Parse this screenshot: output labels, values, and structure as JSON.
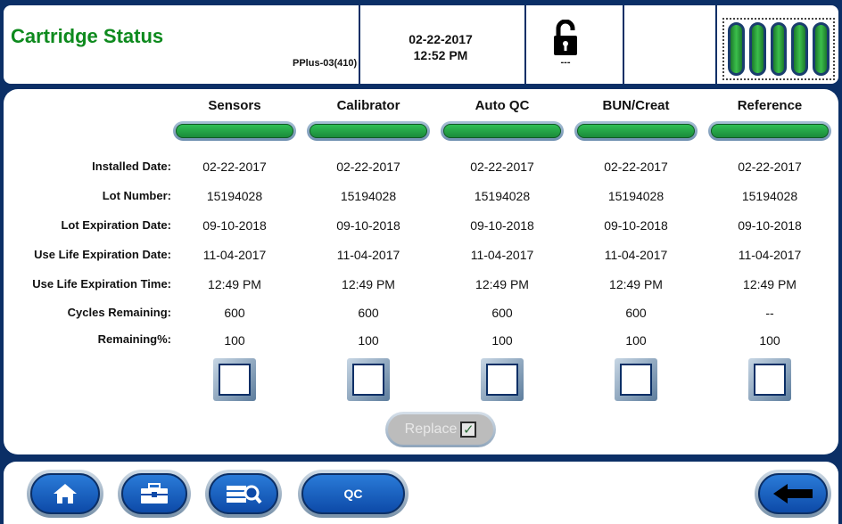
{
  "header": {
    "title": "Cartridge Status",
    "model": "PPlus-03(410)",
    "date": "02-22-2017",
    "time": "12:52 PM",
    "lock_status": "---",
    "battery_cells": 5
  },
  "columns": [
    {
      "name": "Sensors",
      "installed_date": "02-22-2017",
      "lot_number": "15194028",
      "lot_exp": "09-10-2018",
      "use_life_date": "11-04-2017",
      "use_life_time": "12:49 PM",
      "cycles": "600",
      "remaining": "100"
    },
    {
      "name": "Calibrator",
      "installed_date": "02-22-2017",
      "lot_number": "15194028",
      "lot_exp": "09-10-2018",
      "use_life_date": "11-04-2017",
      "use_life_time": "12:49 PM",
      "cycles": "600",
      "remaining": "100"
    },
    {
      "name": "Auto QC",
      "installed_date": "02-22-2017",
      "lot_number": "15194028",
      "lot_exp": "09-10-2018",
      "use_life_date": "11-04-2017",
      "use_life_time": "12:49 PM",
      "cycles": "600",
      "remaining": "100"
    },
    {
      "name": "BUN/Creat",
      "installed_date": "02-22-2017",
      "lot_number": "15194028",
      "lot_exp": "09-10-2018",
      "use_life_date": "11-04-2017",
      "use_life_time": "12:49 PM",
      "cycles": "600",
      "remaining": "100"
    },
    {
      "name": "Reference",
      "installed_date": "02-22-2017",
      "lot_number": "15194028",
      "lot_exp": "09-10-2018",
      "use_life_date": "11-04-2017",
      "use_life_time": "12:49 PM",
      "cycles": "--",
      "remaining": "100"
    }
  ],
  "row_labels": {
    "installed_date": "Installed Date:",
    "lot_number": "Lot Number:",
    "lot_exp": "Lot Expiration Date:",
    "use_life_date": "Use Life Expiration Date:",
    "use_life_time": "Use Life Expiration Time:",
    "cycles": "Cycles Remaining:",
    "remaining": "Remaining%:"
  },
  "replace_button": {
    "label": "Replace",
    "enabled": false
  },
  "nav": {
    "home_icon": "home-icon",
    "tools_icon": "toolbox-icon",
    "search_icon": "list-search-icon",
    "qc_label": "QC",
    "back_icon": "back-arrow-icon"
  },
  "colors": {
    "accent_green": "#0e8a1e",
    "nav_blue": "#0b2f66",
    "status_green": "#1b8a3a"
  }
}
